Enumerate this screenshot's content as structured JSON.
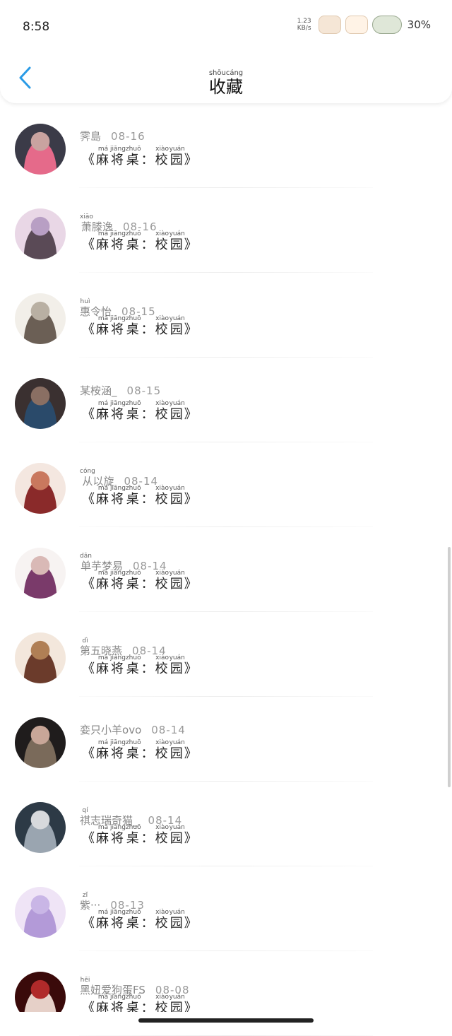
{
  "status": {
    "time": "8:58",
    "net_speed_value": "1.23",
    "net_speed_unit": "KB/s",
    "battery": "30%"
  },
  "header": {
    "title_chars": [
      "收",
      "藏"
    ],
    "title_pinyin": [
      "shōu",
      "cáng"
    ]
  },
  "book": {
    "open": "《",
    "close": "》",
    "chars": [
      "麻",
      "将",
      "桌",
      "：",
      "校",
      "园"
    ],
    "pinyin": [
      "má",
      "jiāng",
      "zhuō",
      "",
      "xiào",
      "yuán"
    ]
  },
  "colors": {
    "accent": "#2A9BE6"
  },
  "items": [
    {
      "name": "霁",
      "name_pinyin": "",
      "date": "08-16",
      "name_rest": "島"
    },
    {
      "name": "萧",
      "name_pinyin": "xiāo",
      "date": "08-16",
      "name_rest": "滕逸"
    },
    {
      "name": "惠",
      "name_pinyin": "huì",
      "date": "08-15",
      "name_rest": "令怡"
    },
    {
      "name": "某",
      "name_pinyin": "",
      "date": "08-15",
      "name_rest": "桉涵_"
    },
    {
      "name": "从",
      "name_pinyin": "cóng",
      "date": "08-14",
      "name_rest": "以旋"
    },
    {
      "name": "单",
      "name_pinyin": "dān",
      "date": "08-14",
      "name_rest": "芋梦易"
    },
    {
      "name": "第",
      "name_pinyin": "dì",
      "date": "08-14",
      "name_rest": "五晓燕"
    },
    {
      "name": "娈",
      "name_pinyin": "",
      "date": "08-14",
      "name_rest": "只小羊ovo"
    },
    {
      "name": "祺",
      "name_pinyin": "qí",
      "date": "08-14",
      "name_rest": "志瑞奇猫_"
    },
    {
      "name": "紫",
      "name_pinyin": "zǐ",
      "date": "08-13",
      "name_rest": "···"
    },
    {
      "name": "黑",
      "name_pinyin": "hēi",
      "date": "08-08",
      "name_rest": "妞爱狗蛋FS"
    }
  ]
}
